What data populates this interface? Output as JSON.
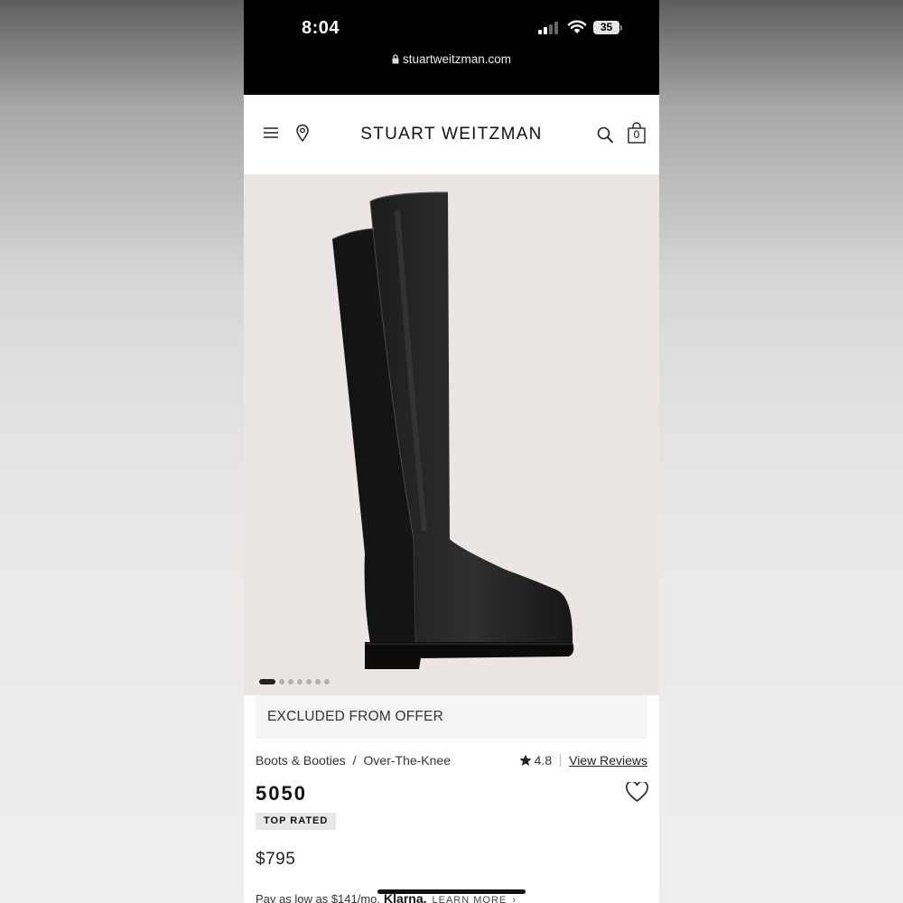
{
  "status_bar": {
    "time": "8:04",
    "battery": "35",
    "url": "stuartweitzman.com"
  },
  "header": {
    "brand": "STUART WEITZMAN",
    "bag_count": "0",
    "icons": [
      "menu-icon",
      "location-pin-icon",
      "search-icon",
      "shopping-bag-icon"
    ]
  },
  "gallery": {
    "image_count": 7,
    "active_index": 0
  },
  "product": {
    "offer_notice": "EXCLUDED FROM OFFER",
    "breadcrumb": [
      "Boots & Booties",
      "Over-The-Knee"
    ],
    "breadcrumb_separator": "/",
    "rating": "4.8",
    "view_reviews": "View Reviews",
    "name": "5050",
    "badge": "TOP RATED",
    "price": "$795",
    "installment_text": "Pay as low as $141/mo.",
    "installment_provider": "Klarna.",
    "learn_more": "LEARN MORE"
  },
  "colors": {
    "hero_bg": "#ebe6e4",
    "status_bg": "#000000",
    "text": "#111111"
  }
}
